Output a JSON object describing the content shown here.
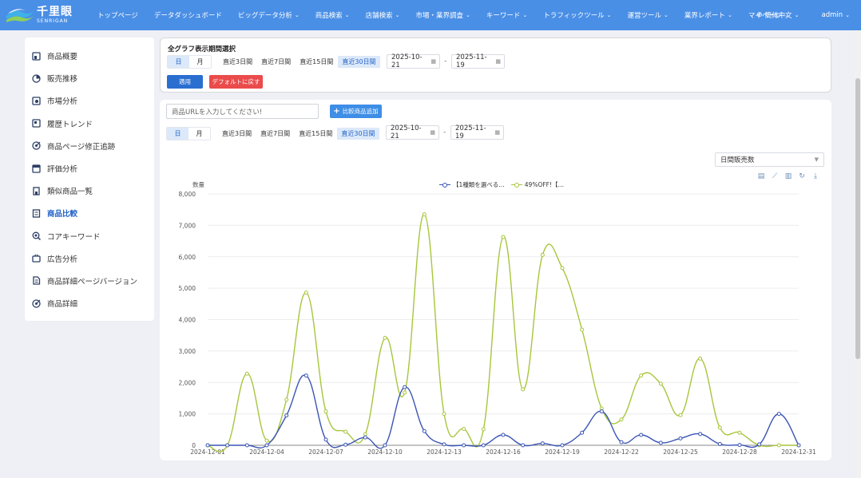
{
  "nav": {
    "logo_cn": "千里眼",
    "logo_en": "SENRIGAN",
    "items": [
      {
        "label": "トップページ",
        "dropdown": false
      },
      {
        "label": "データダッシュボード",
        "dropdown": false
      },
      {
        "label": "ビッグデータ分析",
        "dropdown": true
      },
      {
        "label": "商品検索",
        "dropdown": true
      },
      {
        "label": "店舗検索",
        "dropdown": true
      },
      {
        "label": "市場・業界調査",
        "dropdown": true
      },
      {
        "label": "キーワード",
        "dropdown": true
      },
      {
        "label": "トラフィックツール",
        "dropdown": true
      },
      {
        "label": "運営ツール",
        "dropdown": true
      },
      {
        "label": "業界レポート",
        "dropdown": true
      },
      {
        "label": "マイページ",
        "dropdown": true
      }
    ],
    "language": "簡体中文",
    "user": "admin"
  },
  "sidebar": {
    "items": [
      {
        "label": "商品概要",
        "icon": "overview-icon",
        "active": false
      },
      {
        "label": "販売推移",
        "icon": "pie-chart-icon",
        "active": false
      },
      {
        "label": "市場分析",
        "icon": "market-icon",
        "active": false
      },
      {
        "label": "履歴トレンド",
        "icon": "history-icon",
        "active": false
      },
      {
        "label": "商品ページ修正追跡",
        "icon": "target-icon",
        "active": false
      },
      {
        "label": "評価分析",
        "icon": "review-icon",
        "active": false
      },
      {
        "label": "類似商品一覧",
        "icon": "similar-icon",
        "active": false
      },
      {
        "label": "商品比較",
        "icon": "compare-icon",
        "active": true
      },
      {
        "label": "コアキーワード",
        "icon": "keyword-search-icon",
        "active": false
      },
      {
        "label": "広告分析",
        "icon": "ad-icon",
        "active": false
      },
      {
        "label": "商品詳細ページバージョン",
        "icon": "document-icon",
        "active": false
      },
      {
        "label": "商品詳細",
        "icon": "detail-target-icon",
        "active": false
      }
    ]
  },
  "global_period": {
    "title": "全グラフ表示期間選択",
    "granularity": [
      "日",
      "月"
    ],
    "granularity_selected": "日",
    "ranges": [
      "直近3日間",
      "直近7日間",
      "直近15日間",
      "直近30日間"
    ],
    "range_selected": "直近30日間",
    "start_date": "2025-10-21",
    "end_date": "2025-11-19",
    "separator": "-",
    "apply_label": "適用",
    "reset_label": "デフォルトに戻す"
  },
  "compare": {
    "url_placeholder": "商品URLを入力してください!",
    "add_label": "比較商品追加",
    "granularity": [
      "日",
      "月"
    ],
    "ranges": [
      "直近3日間",
      "直近7日間",
      "直近15日間",
      "直近30日間"
    ],
    "start_date": "2025-10-21",
    "end_date": "2025-11-19",
    "separator": "-",
    "metric_selected": "日間販売数"
  },
  "toolbox": [
    "data-view-icon",
    "line-chart-icon",
    "bar-chart-icon",
    "refresh-icon",
    "download-icon"
  ],
  "chart_data": {
    "type": "line",
    "ylabel": "数量",
    "ylim": [
      0,
      8000
    ],
    "yticks": [
      0,
      1000,
      2000,
      3000,
      4000,
      5000,
      6000,
      7000,
      8000
    ],
    "ytick_labels": [
      "0",
      "1,000",
      "2,000",
      "3,000",
      "4,000",
      "5,000",
      "6,000",
      "7,000",
      "8,000"
    ],
    "x": [
      "2024-12-01",
      "2024-12-02",
      "2024-12-03",
      "2024-12-04",
      "2024-12-05",
      "2024-12-06",
      "2024-12-07",
      "2024-12-08",
      "2024-12-09",
      "2024-12-10",
      "2024-12-11",
      "2024-12-12",
      "2024-12-13",
      "2024-12-14",
      "2024-12-15",
      "2024-12-16",
      "2024-12-17",
      "2024-12-18",
      "2024-12-19",
      "2024-12-20",
      "2024-12-21",
      "2024-12-22",
      "2024-12-23",
      "2024-12-24",
      "2024-12-25",
      "2024-12-26",
      "2024-12-27",
      "2024-12-28",
      "2024-12-29",
      "2024-12-30",
      "2024-12-31"
    ],
    "xtick_labels": [
      "2024-12-01",
      "2024-12-04",
      "2024-12-07",
      "2024-12-10",
      "2024-12-13",
      "2024-12-16",
      "2024-12-19",
      "2024-12-22",
      "2024-12-25",
      "2024-12-28",
      "2024-12-31"
    ],
    "legend_position": "top-center",
    "grid": true,
    "series": [
      {
        "name": "【1種類を選べる…",
        "color": "#3b55b5",
        "values": [
          0,
          0,
          0,
          0,
          950,
          2220,
          180,
          20,
          250,
          0,
          1850,
          450,
          30,
          0,
          0,
          330,
          0,
          60,
          0,
          400,
          1080,
          100,
          330,
          80,
          220,
          360,
          40,
          10,
          30,
          1000,
          0
        ]
      },
      {
        "name": "49%OFF!【…",
        "color": "#a7c63c",
        "values": [
          0,
          0,
          2280,
          150,
          1450,
          4860,
          1080,
          430,
          350,
          3420,
          1680,
          7350,
          1000,
          520,
          510,
          6630,
          1780,
          6060,
          5640,
          3680,
          1170,
          820,
          2220,
          1960,
          960,
          2760,
          560,
          400,
          0,
          0,
          0
        ]
      }
    ]
  }
}
